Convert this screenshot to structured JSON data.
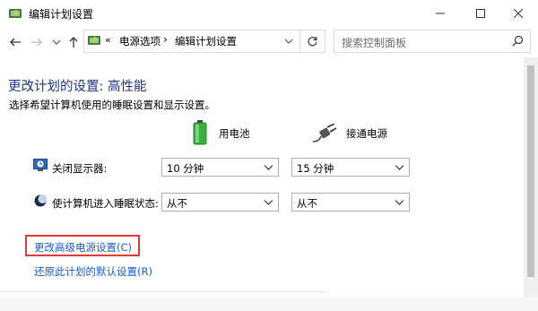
{
  "window": {
    "title": "编辑计划设置",
    "minimize_icon": "minimize-icon",
    "maximize_icon": "maximize-icon",
    "close_icon": "close-icon"
  },
  "address": {
    "breadcrumb_prefix": "«",
    "crumb1": "电源选项",
    "separator": "›",
    "crumb2": "编辑计划设置"
  },
  "search": {
    "placeholder": "搜索控制面板"
  },
  "content": {
    "title": "更改计划的设置: 高性能",
    "subtitle": "选择希望计算机使用的睡眠设置和显示设置。",
    "col_battery": "用电池",
    "col_plugged": "接通电源",
    "rows": [
      {
        "label": "关闭显示器:",
        "battery": "10 分钟",
        "plugged": "15 分钟"
      },
      {
        "label": "使计算机进入睡眠状态:",
        "battery": "从不",
        "plugged": "从不"
      }
    ],
    "link_advanced": "更改高级电源设置(C)",
    "link_restore": "还原此计划的默认设置(R)"
  },
  "colors": {
    "title": "#1e3287",
    "link": "#1a5ad6",
    "highlight_box": "#e53935"
  }
}
